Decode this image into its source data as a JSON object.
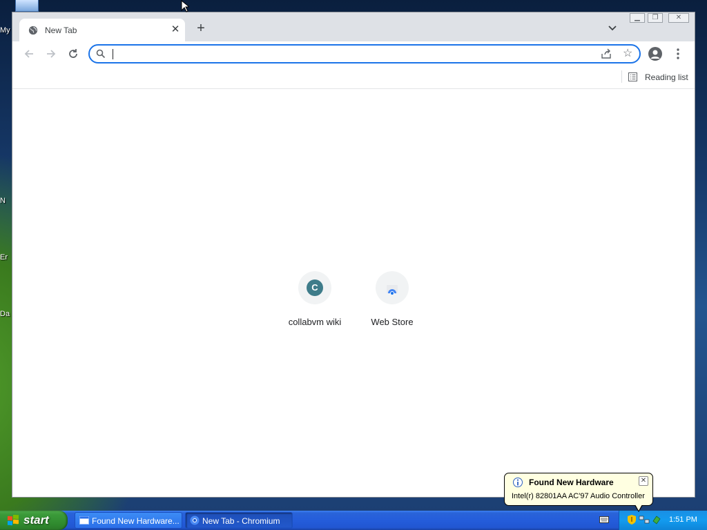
{
  "desktop": {
    "fragments": [
      "My",
      "N",
      "Er",
      "Da"
    ]
  },
  "browser": {
    "tab": {
      "title": "New Tab",
      "favicon": "globe-icon"
    },
    "toolbar": {
      "back_icon": "arrow-left-icon",
      "forward_icon": "arrow-right-icon",
      "reload_icon": "reload-icon",
      "omnibox": {
        "value": "",
        "placeholder": ""
      }
    },
    "bookmark_bar": {
      "reading_list_label": "Reading list"
    },
    "shortcuts": [
      {
        "label": "collabvm wiki",
        "letter": "C"
      },
      {
        "label": "Web Store"
      }
    ],
    "colors": {
      "accent": "#1a73e8",
      "tabstrip": "#dee1e6"
    }
  },
  "taskbar": {
    "start_label": "start",
    "buttons": [
      {
        "label": "Found New Hardware..."
      },
      {
        "label": "New Tab - Chromium"
      }
    ],
    "clock": "1:51 PM"
  },
  "balloon": {
    "title": "Found New Hardware",
    "message": "Intel(r) 82801AA AC'97 Audio Controller"
  }
}
